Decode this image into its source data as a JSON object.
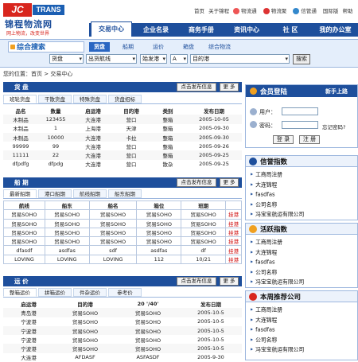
{
  "logo": {
    "jc": "JC",
    "trans": "TRANS",
    "cn": "锦程物流网",
    "slogan": "网上物流，改变世界"
  },
  "toplinks": [
    "首页",
    "关于锦程",
    "物流通",
    "物流聚",
    "信管通",
    "国际版",
    "帮助"
  ],
  "nav": [
    "交易中心",
    "企业名录",
    "商务手册",
    "资讯中心",
    "社 区",
    "我的办公室"
  ],
  "search": {
    "title": "综合搜索",
    "tabs": [
      "货盘",
      "船期",
      "运价",
      "箱盘",
      "综合物流"
    ],
    "selects": [
      "货盘",
      "出货航线",
      "始发港",
      "A",
      "目的港"
    ],
    "button": "搜索"
  },
  "breadcrumb": "您的位置：首页 > 交易中心",
  "cargo": {
    "title": "货 盘",
    "post": "点击发布信息",
    "more": "更 多",
    "tabs": [
      "班轮货盘",
      "干散货盘",
      "特殊货盘",
      "货盘招标"
    ],
    "columns": [
      "品名",
      "数量",
      "启运港",
      "目的港",
      "类别",
      "发布日期"
    ],
    "rows": [
      [
        "木制品",
        "123455",
        "大连港",
        "营口",
        "整箱",
        "2005-10-05"
      ],
      [
        "木制品",
        "1",
        "上海港",
        "天津",
        "整箱",
        "2005-09-30"
      ],
      [
        "木制品",
        "10000",
        "大连港",
        "卡拉",
        "整箱",
        "2005-09-30"
      ],
      [
        "99999",
        "99",
        "大连港",
        "营口",
        "整箱",
        "2005-09-26"
      ],
      [
        "11111",
        "22",
        "大连港",
        "营口",
        "整箱",
        "2005-09-25"
      ],
      [
        "dfpdfg",
        "dfpdg",
        "大连港",
        "营口",
        "散杂",
        "2005-09-25"
      ]
    ]
  },
  "shipping": {
    "title": "船 期",
    "post": "点击发布信息",
    "more": "更 多",
    "tabs": [
      "最新船期",
      "港口船期",
      "航线船期",
      "船东船期"
    ],
    "columns": [
      "航线",
      "船东",
      "船名",
      "箱位",
      "班期",
      ""
    ],
    "rows": [
      [
        "贸易SOHO",
        "贸易SOHO",
        "贸易SOHO",
        "贸易SOHO",
        "贸易SOHO",
        "挂港"
      ],
      [
        "贸易SOHO",
        "贸易SOHO",
        "贸易SOHO",
        "贸易SOHO",
        "贸易SOHO",
        "挂港"
      ],
      [
        "贸易SOHO",
        "贸易SOHO",
        "贸易SOHO",
        "贸易SOHO",
        "贸易SOHO",
        "挂港"
      ],
      [
        "贸易SOHO",
        "贸易SOHO",
        "贸易SOHO",
        "贸易SOHO",
        "贸易SOHO",
        "挂港"
      ],
      [
        "dfasdf",
        "asdfas",
        "sdf",
        "asdfas",
        "df",
        "挂港"
      ],
      [
        "LOVING",
        "LOVING",
        "LOVING",
        "112",
        "10/21",
        "挂港"
      ]
    ]
  },
  "freight": {
    "title": "运 价",
    "post": "点击发布信息",
    "more": "更 多",
    "tabs": [
      "整箱运价",
      "拼箱运价",
      "件杂运价",
      "参考价"
    ],
    "columns": [
      "启运港",
      "目的港",
      "20 '/40'",
      "发布日期"
    ],
    "rows": [
      [
        "青岛港",
        "贸易SOHO",
        "贸易SOHO",
        "2005-10-5"
      ],
      [
        "宁波港",
        "贸易SOHO",
        "贸易SOHO",
        "2005-10-5"
      ],
      [
        "宁波港",
        "贸易SOHO",
        "贸易SOHO",
        "2005-10-5"
      ],
      [
        "宁波港",
        "贸易SOHO",
        "贸易SOHO",
        "2005-10-5"
      ],
      [
        "宁波港",
        "贸易SOHO",
        "贸易SOHO",
        "2005-10-5"
      ],
      [
        "大连港",
        "AFDASF",
        "ASFASDF",
        "2005-9-30"
      ]
    ]
  },
  "login": {
    "title": "会员登陆",
    "newbie": "新手上路",
    "user_label": "用户：",
    "pwd_label": "密码：",
    "remember": "忘记密码?",
    "login_btn": "登 录",
    "register_btn": "注 册"
  },
  "credit": {
    "title": "信誉指数",
    "items": [
      "工商局注册",
      "大连锦程",
      "fasdfas",
      "公司名称",
      "冯宝宝航运有限公司"
    ]
  },
  "active": {
    "title": "活跃指数",
    "items": [
      "工商局注册",
      "大连锦程",
      "fasdfas",
      "公司名称",
      "冯宝宝航运有限公司"
    ]
  },
  "recommend": {
    "title": "本周推荐公司",
    "items": [
      "工商局注册",
      "大连锦程",
      "fasdfas",
      "公司名称",
      "冯宝宝航运有限公司"
    ]
  }
}
